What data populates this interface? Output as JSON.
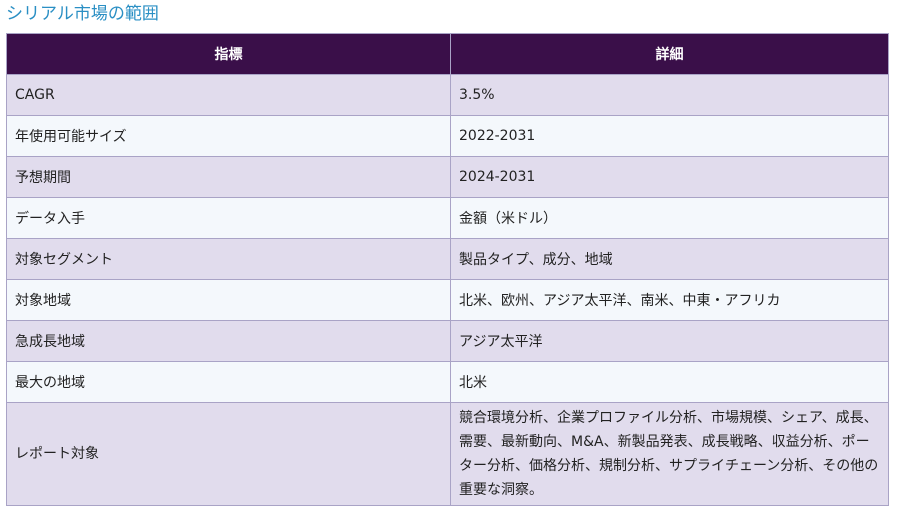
{
  "title": "シリアル市場の範囲",
  "table": {
    "headers": [
      "指標",
      "詳細"
    ],
    "rows": [
      {
        "label": "CAGR",
        "value": "3.5%"
      },
      {
        "label": "年使用可能サイズ",
        "value": "2022-2031"
      },
      {
        "label": "予想期間",
        "value": "2024-2031"
      },
      {
        "label": "データ入手",
        "value": "金額（米ドル）"
      },
      {
        "label": "対象セグメント",
        "value": "製品タイプ、成分、地域"
      },
      {
        "label": "対象地域",
        "value": "北米、欧州、アジア太平洋、南米、中東・アフリカ"
      },
      {
        "label": "急成長地域",
        "value": "アジア太平洋"
      },
      {
        "label": "最大の地域",
        "value": "北米"
      },
      {
        "label": "レポート対象",
        "value": "競合環境分析、企業プロファイル分析、市場規模、シェア、成長、需要、最新動向、M&A、新製品発表、成長戦略、収益分析、ポーター分析、価格分析、規制分析、サプライチェーン分析、その他の重要な洞察。"
      }
    ]
  },
  "colors": {
    "title": "#2a8fc4",
    "header_bg": "#3a0f49",
    "row_odd": "#e1dced",
    "row_even": "#f4f8fc",
    "border": "#a9a3c6"
  }
}
